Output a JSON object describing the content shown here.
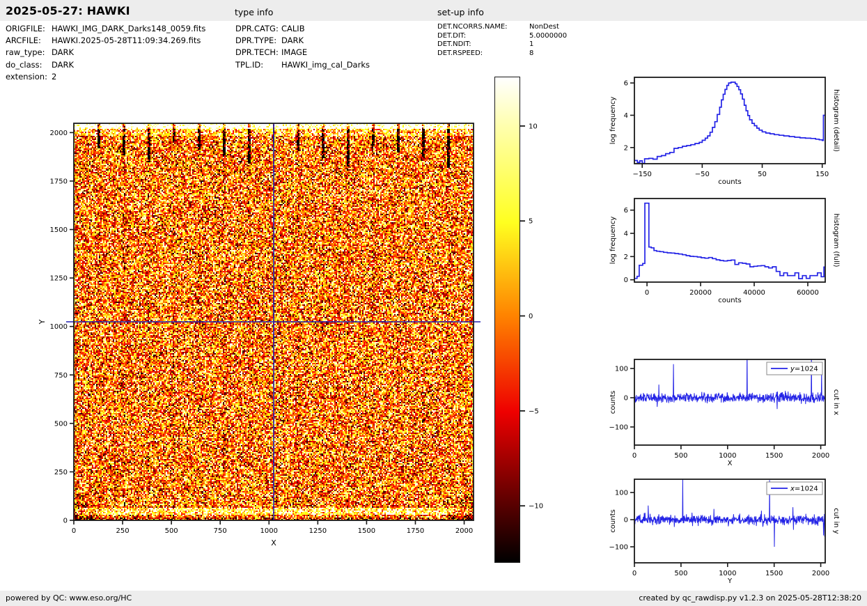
{
  "header": {
    "title": "2025-05-27: HAWKI",
    "type_info_heading": "type info",
    "setup_info_heading": "set-up info"
  },
  "file_info": {
    "rows": [
      {
        "label": "ORIGFILE:",
        "value": "HAWKI_IMG_DARK_Darks148_0059.fits"
      },
      {
        "label": "ARCFILE:",
        "value": "HAWKI.2025-05-28T11:09:34.269.fits"
      },
      {
        "label": "raw_type:",
        "value": "DARK"
      },
      {
        "label": "do_class:",
        "value": "DARK"
      },
      {
        "label": "extension:",
        "value": "2"
      }
    ]
  },
  "type_info": {
    "rows": [
      {
        "label": "DPR.CATG:",
        "value": "CALIB"
      },
      {
        "label": "DPR.TYPE:",
        "value": "DARK"
      },
      {
        "label": "DPR.TECH:",
        "value": "IMAGE"
      },
      {
        "label": "TPL.ID:",
        "value": "HAWKI_img_cal_Darks"
      }
    ]
  },
  "setup_info": {
    "rows": [
      {
        "label": "DET.NCORRS.NAME:",
        "value": "NonDest"
      },
      {
        "label": "DET.DIT:",
        "value": "5.0000000"
      },
      {
        "label": "DET.NDIT:",
        "value": "1"
      },
      {
        "label": "DET.RSPEED:",
        "value": "8"
      }
    ]
  },
  "footer": {
    "left": "powered by QC: www.eso.org/HC",
    "right": "created by qc_rawdisp.py v1.2.3 on 2025-05-28T12:38:20"
  },
  "colors": {
    "plot_line_blue": "#2323e6",
    "crosshair_blue": "#2222b2",
    "header_bg": "#ededed",
    "spine_black": "#1a1a1a",
    "colorbar_stops": [
      {
        "pos": 0,
        "color": "#ffffff"
      },
      {
        "pos": 10,
        "color": "#ffffae"
      },
      {
        "pos": 30,
        "color": "#ffff20"
      },
      {
        "pos": 49,
        "color": "#ff8400"
      },
      {
        "pos": 69,
        "color": "#ee0000"
      },
      {
        "pos": 88,
        "color": "#5a0000"
      },
      {
        "pos": 100,
        "color": "#000000"
      }
    ]
  },
  "chart_data": [
    {
      "id": "raw-image",
      "type": "heatmap",
      "title": "raw dark frame 2048x2048, hot colormap noise",
      "xlabel": "X",
      "ylabel": "Y",
      "xlim": [
        0,
        2048
      ],
      "ylim": [
        0,
        2048
      ],
      "xticks": [
        0,
        250,
        500,
        750,
        1000,
        1250,
        1500,
        1750,
        2000
      ],
      "yticks": [
        0,
        250,
        500,
        750,
        1000,
        1250,
        1500,
        1750,
        2000
      ],
      "crosshair": {
        "x": 1024,
        "y": 1024
      },
      "seed": 42,
      "features": {
        "top_bright_band": true,
        "top_tick_marks": 15,
        "bottom_bright_band": true,
        "dark_bottom_corners": true
      }
    },
    {
      "id": "colorbar",
      "type": "colorbar",
      "ticks": [
        10,
        5,
        0,
        -5,
        -10
      ],
      "vmin": -13.0,
      "vmax": 12.6
    },
    {
      "id": "histogram-detail",
      "type": "step",
      "xlabel": "counts",
      "ylabel": "log frequency",
      "right_label": "histogram (detail)",
      "xlim": [
        -163,
        155
      ],
      "ylim": [
        1.0,
        6.35
      ],
      "xticks": [
        -150,
        -50,
        50,
        150
      ],
      "yticks": [
        2,
        4,
        6
      ],
      "steps": [
        [
          -163,
          1.2
        ],
        [
          -158,
          1.08
        ],
        [
          -154,
          1.18
        ],
        [
          -150,
          1.02
        ],
        [
          -146,
          1.3
        ],
        [
          -139,
          1.33
        ],
        [
          -132,
          1.28
        ],
        [
          -125,
          1.45
        ],
        [
          -118,
          1.5
        ],
        [
          -111,
          1.62
        ],
        [
          -104,
          1.7
        ],
        [
          -97,
          1.95
        ],
        [
          -90,
          2.0
        ],
        [
          -83,
          2.08
        ],
        [
          -76,
          2.12
        ],
        [
          -69,
          2.18
        ],
        [
          -62,
          2.25
        ],
        [
          -55,
          2.32
        ],
        [
          -50,
          2.45
        ],
        [
          -45,
          2.58
        ],
        [
          -41,
          2.72
        ],
        [
          -37,
          2.95
        ],
        [
          -33,
          3.25
        ],
        [
          -29,
          3.6
        ],
        [
          -25,
          4.05
        ],
        [
          -21,
          4.5
        ],
        [
          -18,
          4.95
        ],
        [
          -15,
          5.3
        ],
        [
          -12,
          5.6
        ],
        [
          -9,
          5.85
        ],
        [
          -6,
          6.0
        ],
        [
          -2,
          6.05
        ],
        [
          2,
          6.05
        ],
        [
          5,
          5.95
        ],
        [
          8,
          5.78
        ],
        [
          11,
          5.58
        ],
        [
          14,
          5.32
        ],
        [
          17,
          5.0
        ],
        [
          20,
          4.62
        ],
        [
          23,
          4.28
        ],
        [
          26,
          3.98
        ],
        [
          29,
          3.72
        ],
        [
          33,
          3.5
        ],
        [
          37,
          3.35
        ],
        [
          41,
          3.2
        ],
        [
          45,
          3.08
        ],
        [
          50,
          2.97
        ],
        [
          56,
          2.9
        ],
        [
          63,
          2.85
        ],
        [
          70,
          2.8
        ],
        [
          78,
          2.76
        ],
        [
          86,
          2.72
        ],
        [
          95,
          2.68
        ],
        [
          104,
          2.64
        ],
        [
          113,
          2.6
        ],
        [
          122,
          2.58
        ],
        [
          131,
          2.56
        ],
        [
          139,
          2.52
        ],
        [
          145,
          2.48
        ],
        [
          150,
          2.44
        ],
        [
          152,
          4.0
        ],
        [
          155,
          4.0
        ]
      ]
    },
    {
      "id": "histogram-full",
      "type": "step",
      "xlabel": "counts",
      "ylabel": "log frequency",
      "right_label": "histogram (full)",
      "xlim": [
        -4700,
        66500
      ],
      "ylim": [
        -0.2,
        7.0
      ],
      "xticks": [
        0,
        20000,
        40000,
        60000
      ],
      "yticks": [
        0,
        2,
        4,
        6
      ],
      "steps": [
        [
          -4700,
          0.12
        ],
        [
          -3700,
          0.3
        ],
        [
          -2900,
          1.25
        ],
        [
          -1600,
          1.4
        ],
        [
          -800,
          6.6
        ],
        [
          300,
          6.6
        ],
        [
          700,
          2.82
        ],
        [
          1600,
          2.75
        ],
        [
          2600,
          2.52
        ],
        [
          3600,
          2.46
        ],
        [
          4800,
          2.42
        ],
        [
          6200,
          2.36
        ],
        [
          7600,
          2.32
        ],
        [
          9000,
          2.3
        ],
        [
          10400,
          2.26
        ],
        [
          11800,
          2.22
        ],
        [
          13200,
          2.16
        ],
        [
          14600,
          2.08
        ],
        [
          16000,
          2.02
        ],
        [
          17400,
          2.0
        ],
        [
          18800,
          1.96
        ],
        [
          20200,
          1.9
        ],
        [
          21600,
          1.86
        ],
        [
          23000,
          1.92
        ],
        [
          24400,
          1.82
        ],
        [
          25800,
          1.72
        ],
        [
          27200,
          1.66
        ],
        [
          28600,
          1.62
        ],
        [
          30000,
          1.66
        ],
        [
          31400,
          1.7
        ],
        [
          32800,
          1.32
        ],
        [
          34200,
          1.46
        ],
        [
          35600,
          1.42
        ],
        [
          37000,
          1.36
        ],
        [
          38400,
          1.12
        ],
        [
          39800,
          1.16
        ],
        [
          41200,
          1.2
        ],
        [
          42600,
          1.22
        ],
        [
          44000,
          1.12
        ],
        [
          45400,
          1.02
        ],
        [
          46800,
          1.12
        ],
        [
          48200,
          0.72
        ],
        [
          49600,
          0.36
        ],
        [
          51000,
          0.6
        ],
        [
          52400,
          0.36
        ],
        [
          53800,
          0.36
        ],
        [
          55200,
          0.6
        ],
        [
          56600,
          0.1
        ],
        [
          58000,
          0.36
        ],
        [
          59400,
          0.12
        ],
        [
          60800,
          0.36
        ],
        [
          62200,
          0.36
        ],
        [
          63600,
          0.6
        ],
        [
          65000,
          0.26
        ],
        [
          66000,
          1.1
        ],
        [
          66500,
          1.1
        ]
      ]
    },
    {
      "id": "cut-in-x",
      "type": "noise-line",
      "xlabel": "X",
      "ylabel": "counts",
      "right_label": "cut in x",
      "legend": {
        "var": "y",
        "rest": "=1024"
      },
      "xlim": [
        0,
        2048
      ],
      "ylim": [
        -162,
        131
      ],
      "xticks": [
        0,
        500,
        1000,
        1500,
        2000
      ],
      "yticks": [
        -100,
        0,
        100
      ],
      "noise": {
        "n": 680,
        "sigma": 11,
        "seed": 101
      },
      "spikes": [
        [
          262,
          45
        ],
        [
          420,
          115
        ],
        [
          1210,
          170
        ],
        [
          1900,
          155
        ],
        [
          2008,
          95
        ]
      ]
    },
    {
      "id": "cut-in-y",
      "type": "noise-line",
      "xlabel": "Y",
      "ylabel": "counts",
      "right_label": "cut in y",
      "legend": {
        "var": "x",
        "rest": "=1024"
      },
      "xlim": [
        0,
        2048
      ],
      "ylim": [
        -159,
        149
      ],
      "xticks": [
        0,
        500,
        1000,
        1500,
        2000
      ],
      "yticks": [
        -100,
        0,
        100
      ],
      "noise": {
        "n": 680,
        "sigma": 12,
        "seed": 202
      },
      "spikes": [
        [
          148,
          52
        ],
        [
          520,
          152
        ],
        [
          1450,
          146
        ],
        [
          1502,
          -100
        ],
        [
          1700,
          46
        ],
        [
          2030,
          -58
        ],
        [
          2042,
          -62
        ]
      ]
    }
  ]
}
